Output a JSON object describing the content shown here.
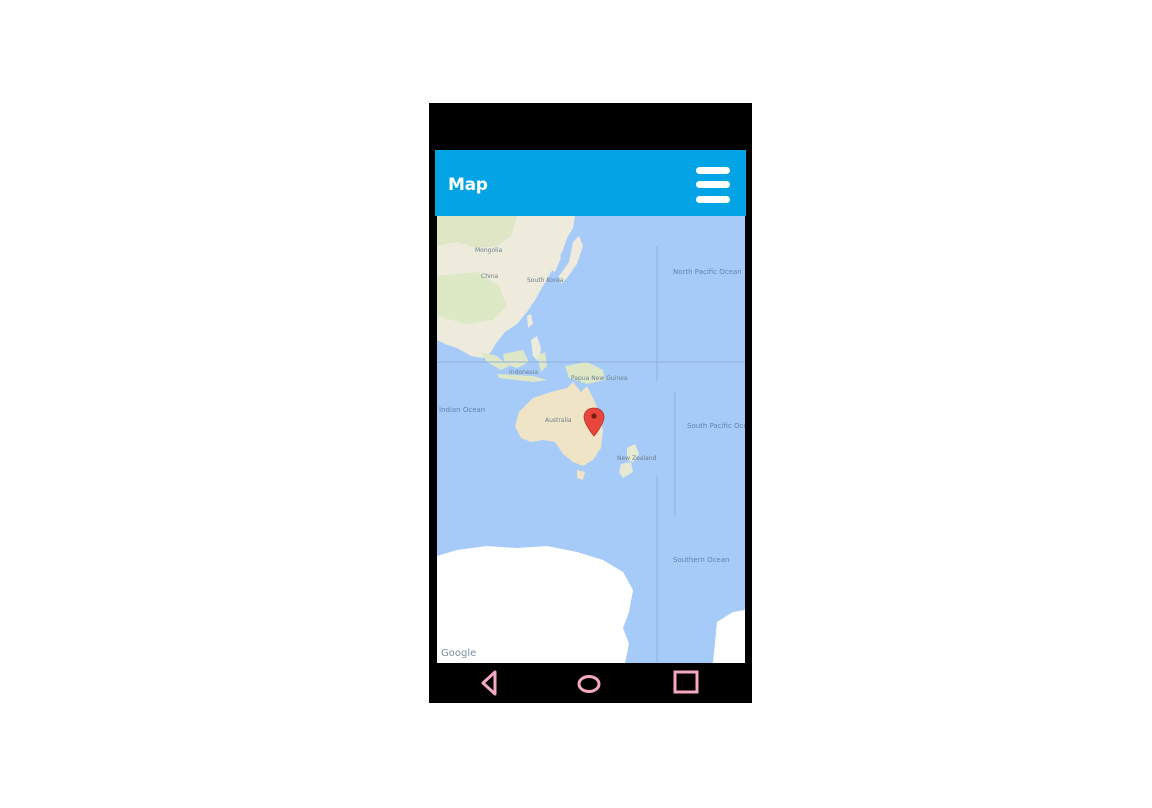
{
  "app_bar": {
    "title": "Map",
    "background_color": "#02a4e6",
    "menu_icon": "hamburger-menu-icon"
  },
  "map": {
    "attribution": "Google",
    "marker_icon": "map-pin-icon",
    "marker_color": "#e8453c",
    "labels": {
      "mongolia": "Mongolia",
      "china": "China",
      "south_korea": "South Korea",
      "north_pacific_ocean": "North Pacific Ocean",
      "indonesia": "Indonesia",
      "papua_new_guinea": "Papua New Guinea",
      "indian_ocean": "Indian Ocean",
      "australia": "Australia",
      "new_zealand": "New Zealand",
      "south_pacific_ocean": "South Pacific Ocean",
      "southern_ocean": "Southern Ocean"
    }
  },
  "nav_bar": {
    "back_icon": "back-triangle-icon",
    "home_icon": "home-circle-icon",
    "recents_icon": "recents-square-icon",
    "icon_color": "#f4a8c4"
  }
}
